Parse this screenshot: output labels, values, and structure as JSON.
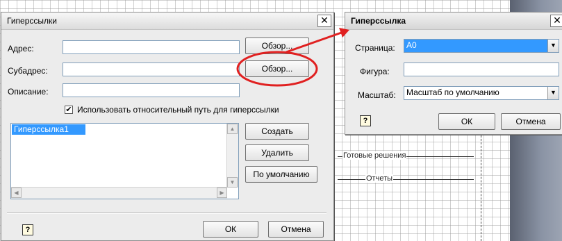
{
  "colors": {
    "highlight": "#3399ff",
    "annotation": "#e02020",
    "dialog_bg": "#ececec"
  },
  "hyperlinks_dialog": {
    "title": "Гиперссылки",
    "close_glyph": "✕",
    "address_label": "Адрес:",
    "address_value": "",
    "browse1_label": "Обзор...",
    "subaddress_label": "Субадрес:",
    "subaddress_value": "",
    "browse2_label": "Обзор...",
    "description_label": "Описание:",
    "description_value": "",
    "relative_path_checked": true,
    "relative_path_label": "Использовать относительный путь для гиперссылки",
    "list_items": [
      "Гиперссылка1"
    ],
    "create_label": "Создать",
    "delete_label": "Удалить",
    "default_label": "По умолчанию",
    "help_glyph": "?",
    "ok_label": "ОК",
    "cancel_label": "Отмена"
  },
  "hyperlink_dialog": {
    "title": "Гиперссылка",
    "close_glyph": "✕",
    "page_label": "Страница:",
    "page_value": "А0",
    "shape_label": "Фигура:",
    "shape_value": "",
    "scale_label": "Масштаб:",
    "scale_value": "Масштаб по умолчанию",
    "help_glyph": "?",
    "ok_label": "ОК",
    "cancel_label": "Отмена"
  },
  "diagram": {
    "label_ready": "Готовые решения",
    "label_reports": "Отчеты"
  }
}
